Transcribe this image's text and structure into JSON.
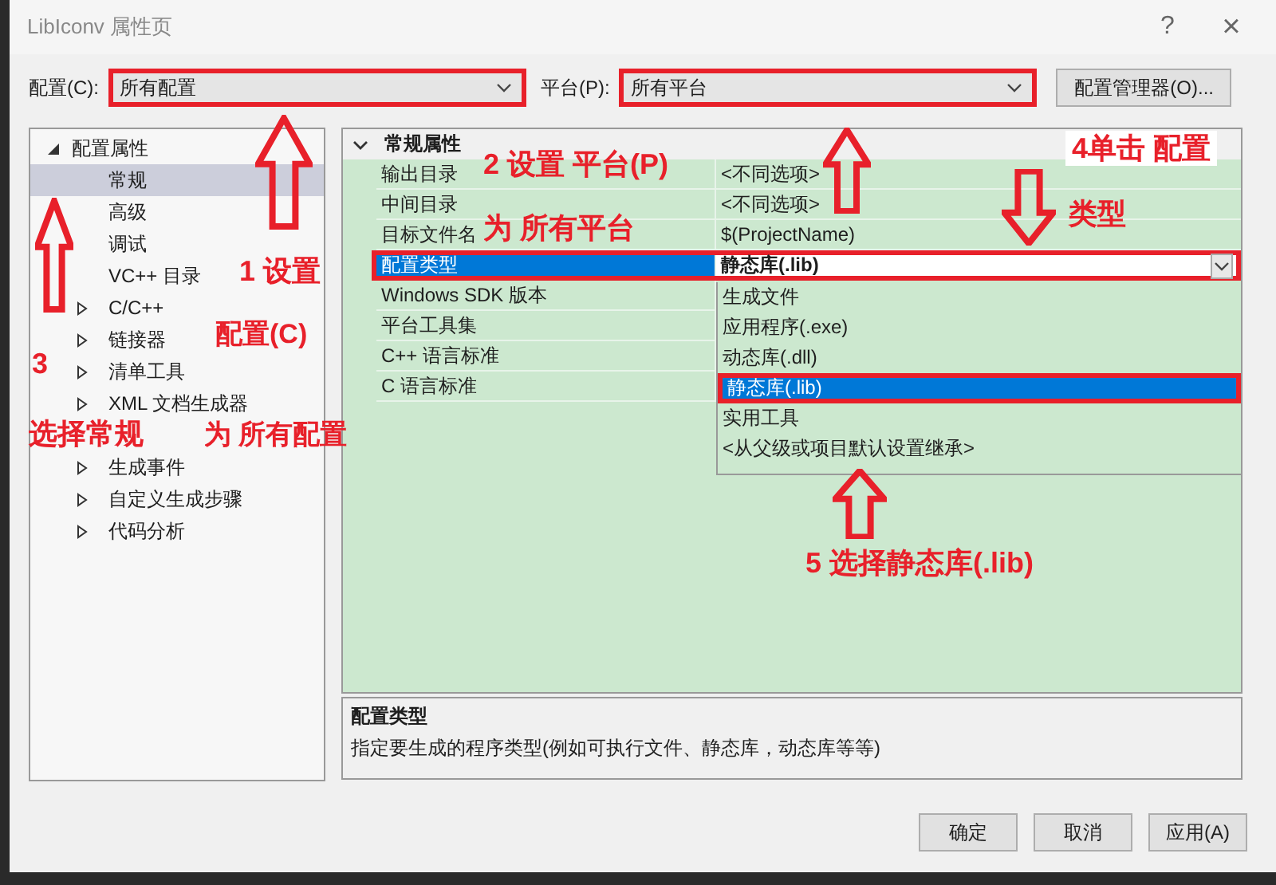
{
  "window": {
    "title": "LibIconv 属性页",
    "help": "?",
    "close": "×"
  },
  "toolbar": {
    "config_label": "配置(C):",
    "config_value": "所有配置",
    "config_outlined": true,
    "platform_label": "平台(P):",
    "platform_value": "所有平台",
    "platform_outlined": true,
    "manager_button": "配置管理器(O)..."
  },
  "tree": [
    {
      "label": "配置属性",
      "expanded": true,
      "selected": false,
      "children": [
        {
          "label": "常规",
          "selected": true,
          "expandable": false
        },
        {
          "label": "高级",
          "selected": false,
          "expandable": false
        },
        {
          "label": "调试",
          "selected": false,
          "expandable": false
        },
        {
          "label": "VC++ 目录",
          "selected": false,
          "expandable": false
        },
        {
          "label": "C/C++",
          "selected": false,
          "expandable": true
        },
        {
          "label": "链接器",
          "selected": false,
          "expandable": true
        },
        {
          "label": "清单工具",
          "selected": false,
          "expandable": true
        },
        {
          "label": "XML 文档生成器",
          "selected": false,
          "expandable": true
        },
        {
          "label": "生成事件",
          "selected": false,
          "expandable": true
        },
        {
          "label": "自定义生成步骤",
          "selected": false,
          "expandable": true
        },
        {
          "label": "代码分析",
          "selected": false,
          "expandable": true
        }
      ]
    }
  ],
  "grid": {
    "category": "常规属性",
    "expanded": true,
    "rows": [
      {
        "name": "输出目录",
        "value": "<不同选项>",
        "selected": false
      },
      {
        "name": "中间目录",
        "value": "<不同选项>",
        "selected": false
      },
      {
        "name": "目标文件名",
        "value": "$(ProjectName)",
        "selected": false
      },
      {
        "name": "配置类型",
        "value": "静态库(.lib)",
        "selected": true,
        "outlined": true
      },
      {
        "name": "Windows SDK 版本",
        "selected": false
      },
      {
        "name": "平台工具集",
        "selected": false
      },
      {
        "name": "C++ 语言标准",
        "selected": false
      },
      {
        "name": "C 语言标准",
        "selected": false
      }
    ],
    "dropdown": [
      {
        "label": "生成文件",
        "selected": false
      },
      {
        "label": "应用程序(.exe)",
        "selected": false
      },
      {
        "label": "动态库(.dll)",
        "selected": false
      },
      {
        "label": "静态库(.lib)",
        "selected": true,
        "outlined": true
      },
      {
        "label": "实用工具",
        "selected": false
      },
      {
        "label": "<从父级或项目默认设置继承>",
        "selected": false
      }
    ]
  },
  "description": {
    "title": "配置类型",
    "text": "指定要生成的程序类型(例如可执行文件、静态库，动态库等等)"
  },
  "buttons": [
    "确定",
    "取消",
    "应用(A)"
  ],
  "annotations": {
    "labels": [
      {
        "text": "1 设置"
      },
      {
        "text": "配置(C)"
      },
      {
        "text": "为 所有配置"
      },
      {
        "text": "3"
      },
      {
        "text": "选择常规"
      },
      {
        "text": "2 设置 平台(P)"
      },
      {
        "text": "为 所有平台"
      },
      {
        "text": "4单击 配置"
      },
      {
        "text": "类型"
      },
      {
        "text": "5 选择静态库(.lib)"
      }
    ],
    "arrows": [
      {
        "kind": "up"
      },
      {
        "kind": "up"
      },
      {
        "kind": "up"
      },
      {
        "kind": "down"
      },
      {
        "kind": "up"
      }
    ]
  }
}
